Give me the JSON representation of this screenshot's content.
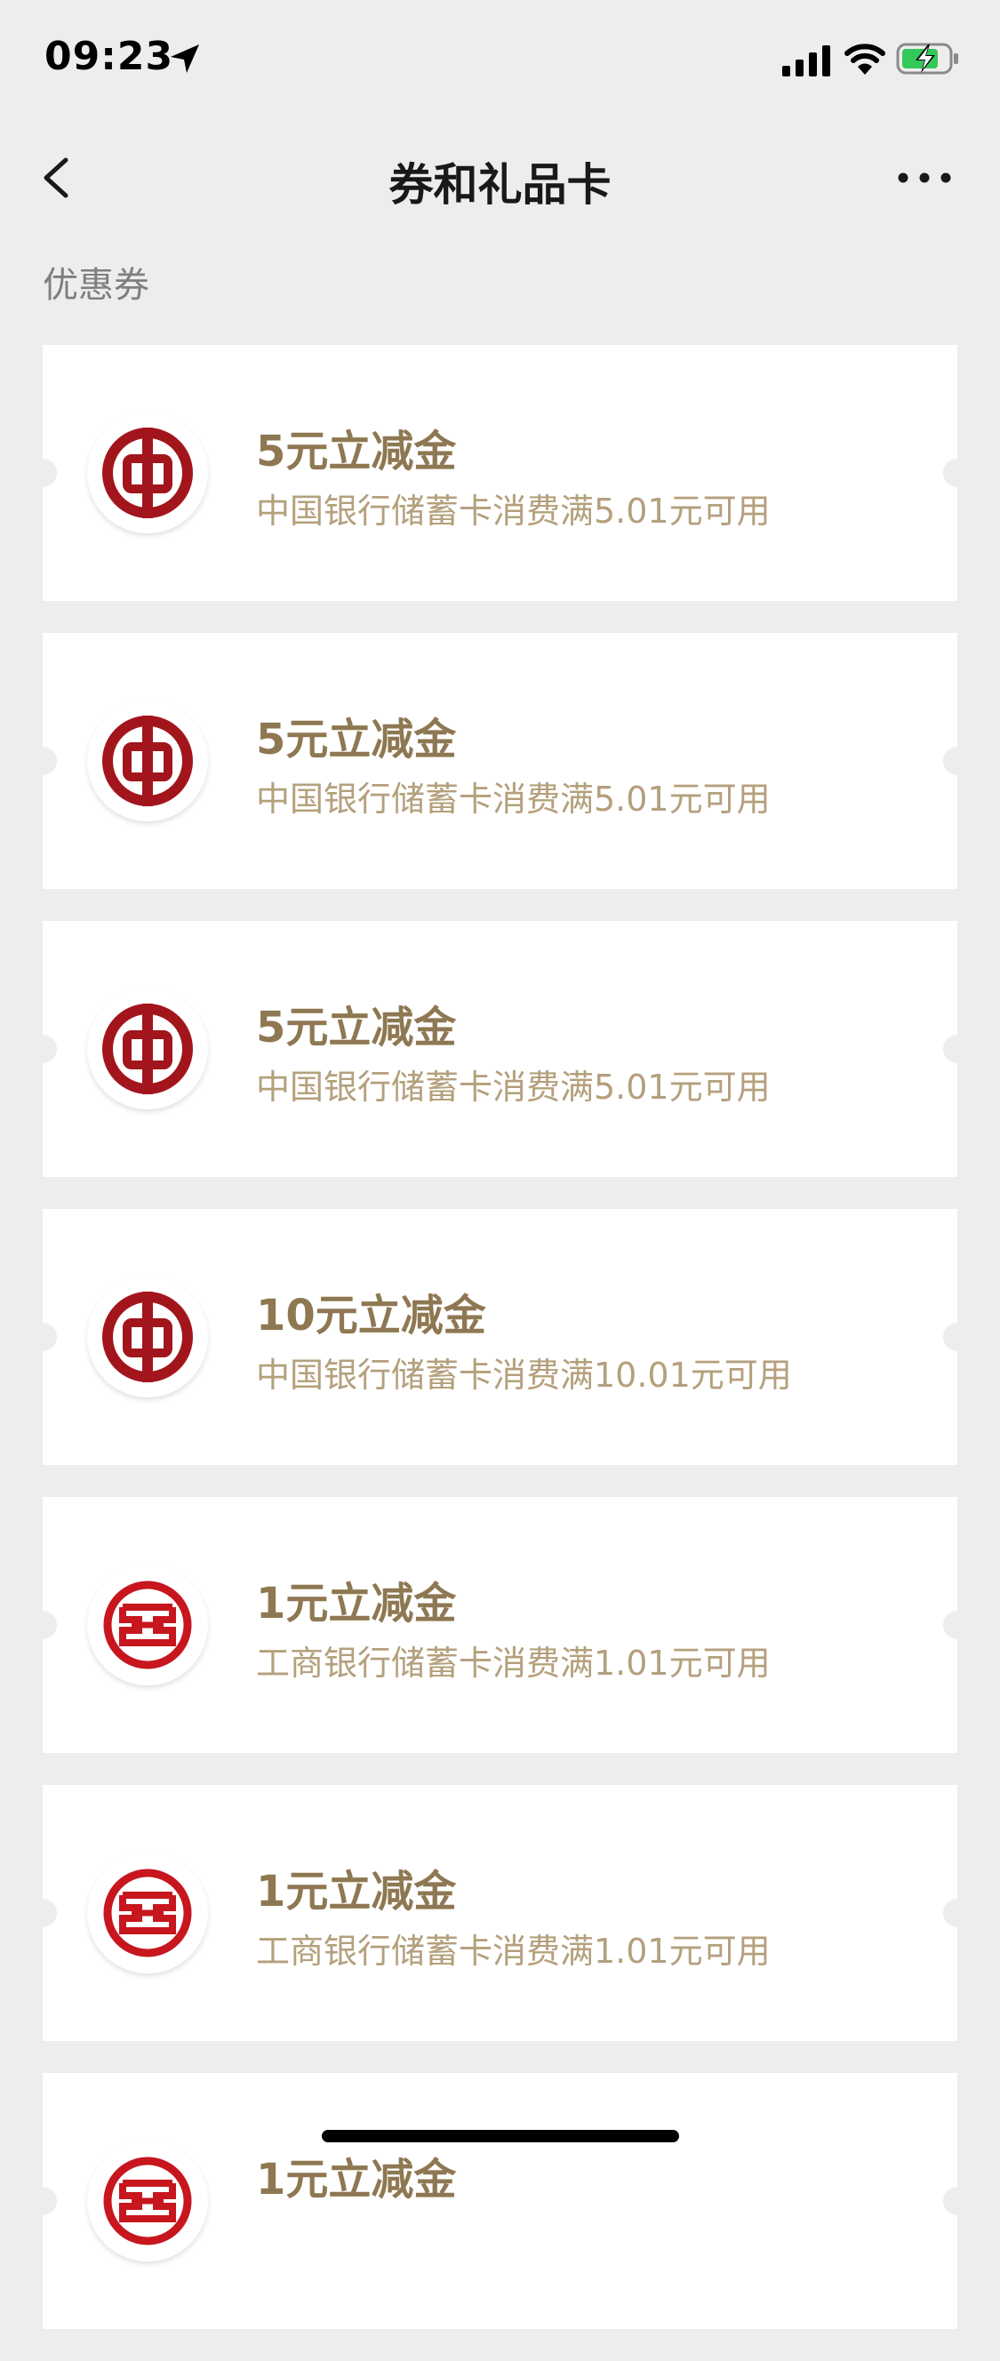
{
  "status_bar": {
    "time": "09:23"
  },
  "nav": {
    "title": "券和礼品卡"
  },
  "section": {
    "label": "优惠券"
  },
  "coupons": [
    {
      "bank": "boc",
      "title": "5元立减金",
      "desc": "中国银行储蓄卡消费满5.01元可用"
    },
    {
      "bank": "boc",
      "title": "5元立减金",
      "desc": "中国银行储蓄卡消费满5.01元可用"
    },
    {
      "bank": "boc",
      "title": "5元立减金",
      "desc": "中国银行储蓄卡消费满5.01元可用"
    },
    {
      "bank": "boc",
      "title": "10元立减金",
      "desc": "中国银行储蓄卡消费满10.01元可用"
    },
    {
      "bank": "icbc",
      "title": "1元立减金",
      "desc": "工商银行储蓄卡消费满1.01元可用"
    },
    {
      "bank": "icbc",
      "title": "1元立减金",
      "desc": "工商银行储蓄卡消费满1.01元可用"
    },
    {
      "bank": "icbc",
      "title": "1元立减金",
      "desc": ""
    }
  ],
  "colors": {
    "background": "#EDEDED",
    "title_gold": "#8E7852",
    "desc_gold": "#B4A07C",
    "boc_red": "#A3151C",
    "icbc_red": "#C7161E"
  }
}
